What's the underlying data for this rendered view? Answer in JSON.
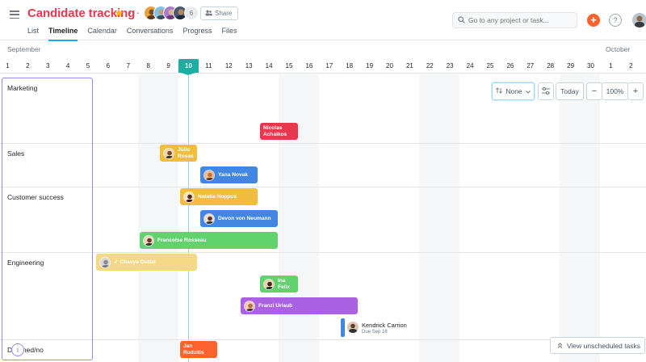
{
  "header": {
    "project_title": "Candidate tracking",
    "member_count": "6",
    "share_label": "Share",
    "tabs": [
      {
        "label": "List"
      },
      {
        "label": "Timeline"
      },
      {
        "label": "Calendar"
      },
      {
        "label": "Conversations"
      },
      {
        "label": "Progress"
      },
      {
        "label": "Files"
      }
    ],
    "active_tab": "Timeline",
    "search_placeholder": "Go to any project or task...",
    "plus_label": "+",
    "help_label": "?"
  },
  "colors": {
    "title": "#e8384f",
    "tab_underline": "#14aaf5",
    "today": "#1aafa0",
    "yellow": "#f1bd3c",
    "pale_yellow": "#f3d885",
    "blue": "#4186e0",
    "green": "#62d26f",
    "red": "#e8384f",
    "purple": "#aa62e3",
    "orange": "#fd612c",
    "section_border": "#9b86ec"
  },
  "timeline": {
    "months": [
      {
        "label": "September"
      },
      {
        "label": "October"
      }
    ],
    "days": [
      "1",
      "2",
      "3",
      "4",
      "5",
      "6",
      "7",
      "8",
      "9",
      "10",
      "11",
      "12",
      "13",
      "14",
      "15",
      "16",
      "17",
      "18",
      "19",
      "20",
      "21",
      "22",
      "23",
      "24",
      "25",
      "26",
      "27",
      "28",
      "29",
      "30",
      "1",
      "2"
    ],
    "today": "10",
    "sections": [
      {
        "name": "Marketing"
      },
      {
        "name": "Sales"
      },
      {
        "name": "Customer success"
      },
      {
        "name": "Engineering"
      },
      {
        "name": "Declined/no"
      }
    ],
    "tasks": [
      {
        "name": "Nicolas Achaikos",
        "line1": "Nicolas",
        "line2": "Achaikos",
        "color": "red",
        "avatar": false
      },
      {
        "name": "Julio Rosas",
        "line1": "Julio",
        "line2": "Rosas",
        "color": "yellow",
        "avatar": true
      },
      {
        "name": "Yana Novak",
        "line1": "Yana Novak",
        "line2": "",
        "color": "blue",
        "avatar": true
      },
      {
        "name": "Natalia Hoppus",
        "line1": "Natalia Hoppus",
        "line2": "",
        "color": "yellow",
        "avatar": true
      },
      {
        "name": "Devon von Neumann",
        "line1": "Devon von Neumann",
        "line2": "",
        "color": "blue",
        "avatar": true
      },
      {
        "name": "Francoise Rosseau",
        "line1": "Francoise Rosseau",
        "line2": "",
        "color": "green",
        "avatar": true
      },
      {
        "name": "Chasya Guttal",
        "line1": "✓ Chasya Guttal",
        "line2": "",
        "color": "pale_yellow",
        "avatar": true
      },
      {
        "name": "Ina Felix",
        "line1": "Ina",
        "line2": "Felix",
        "color": "green",
        "avatar": true
      },
      {
        "name": "Franzi Urlaub",
        "line1": "Franzi Urlaub",
        "line2": "",
        "color": "purple",
        "avatar": true
      },
      {
        "name": "Jan Rudzitis",
        "line1": "Jan",
        "line2": "Rudzitis",
        "color": "orange",
        "avatar": false
      }
    ],
    "milestone": {
      "name": "Kendrick Carrion",
      "due": "Due Sep 18"
    }
  },
  "controls": {
    "sort_label": "None",
    "today_label": "Today",
    "zoom_out": "−",
    "zoom_level": "100%",
    "zoom_in": "+",
    "unscheduled_label": "View unscheduled tasks"
  },
  "icons": [
    "hamburger-icon",
    "star-icon",
    "more-icon",
    "share-icon",
    "search-icon",
    "sort-icon",
    "filter-icon",
    "chevron-down-icon",
    "chevrons-up-icon",
    "info-icon"
  ]
}
